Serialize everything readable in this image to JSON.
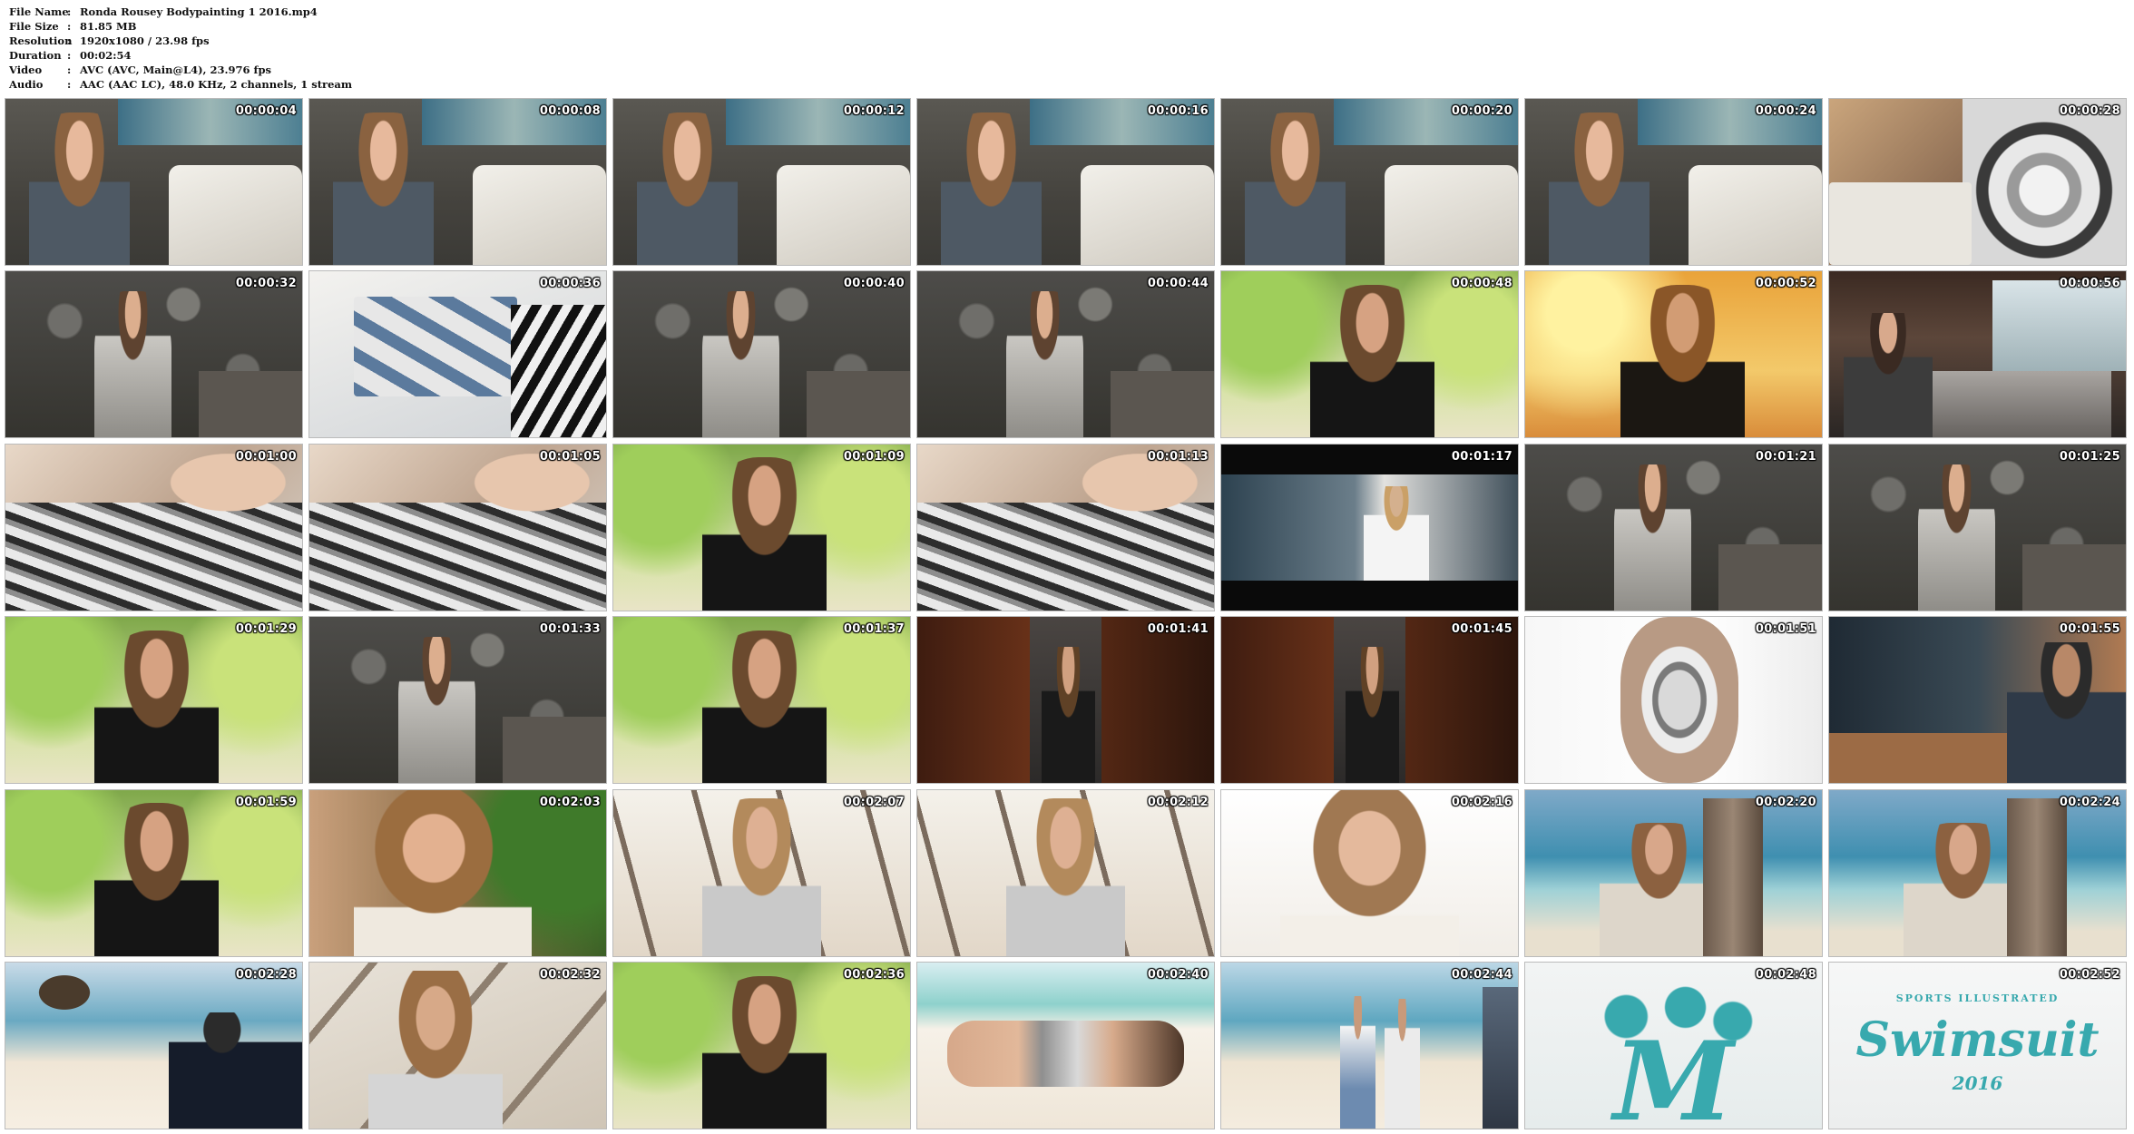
{
  "info": [
    {
      "key": "File Name",
      "value": "Ronda Rousey Bodypainting 1 2016.mp4"
    },
    {
      "key": "File Size",
      "value": "81.85 MB"
    },
    {
      "key": "Resolution",
      "value": "1920x1080 / 23.98 fps"
    },
    {
      "key": "Duration",
      "value": "00:02:54"
    },
    {
      "key": "Video",
      "value": "AVC (AVC, Main@L4), 23.976 fps"
    },
    {
      "key": "Audio",
      "value": "AAC (AAC LC), 48.0 KHz, 2 channels, 1 stream"
    }
  ],
  "info_separator": ":",
  "thumbnails": [
    {
      "time": "00:00:04",
      "scene": "bedroom"
    },
    {
      "time": "00:00:08",
      "scene": "bedroom"
    },
    {
      "time": "00:00:12",
      "scene": "bedroom"
    },
    {
      "time": "00:00:16",
      "scene": "bedroom"
    },
    {
      "time": "00:00:20",
      "scene": "bedroom"
    },
    {
      "time": "00:00:24",
      "scene": "bedroom"
    },
    {
      "time": "00:00:28",
      "scene": "swimsuit-print"
    },
    {
      "time": "00:00:32",
      "scene": "stonewall"
    },
    {
      "time": "00:00:36",
      "scene": "prints-table"
    },
    {
      "time": "00:00:40",
      "scene": "stonewall"
    },
    {
      "time": "00:00:44",
      "scene": "stonewall"
    },
    {
      "time": "00:00:48",
      "scene": "interview-garden"
    },
    {
      "time": "00:00:52",
      "scene": "interview-warm"
    },
    {
      "time": "00:00:56",
      "scene": "studio-room"
    },
    {
      "time": "00:01:00",
      "scene": "closeup-paint"
    },
    {
      "time": "00:01:05",
      "scene": "closeup-paint"
    },
    {
      "time": "00:01:09",
      "scene": "interview-garden"
    },
    {
      "time": "00:01:13",
      "scene": "closeup-paint"
    },
    {
      "time": "00:01:17",
      "scene": "dark-letterbox"
    },
    {
      "time": "00:01:21",
      "scene": "stonewall"
    },
    {
      "time": "00:01:25",
      "scene": "stonewall"
    },
    {
      "time": "00:01:29",
      "scene": "interview-garden"
    },
    {
      "time": "00:01:33",
      "scene": "stonewall"
    },
    {
      "time": "00:01:37",
      "scene": "interview-garden"
    },
    {
      "time": "00:01:41",
      "scene": "wood-door"
    },
    {
      "time": "00:01:45",
      "scene": "wood-door"
    },
    {
      "time": "00:01:51",
      "scene": "white-studio"
    },
    {
      "time": "00:01:55",
      "scene": "photo-shoot"
    },
    {
      "time": "00:01:59",
      "scene": "interview-garden"
    },
    {
      "time": "00:02:03",
      "scene": "portrait-green"
    },
    {
      "time": "00:02:07",
      "scene": "tree-bright"
    },
    {
      "time": "00:02:12",
      "scene": "tree-bright"
    },
    {
      "time": "00:02:16",
      "scene": "portrait-white"
    },
    {
      "time": "00:02:20",
      "scene": "beach-sea"
    },
    {
      "time": "00:02:24",
      "scene": "beach-sea"
    },
    {
      "time": "00:02:28",
      "scene": "beach-shoot"
    },
    {
      "time": "00:02:32",
      "scene": "driftwood"
    },
    {
      "time": "00:02:36",
      "scene": "interview-garden"
    },
    {
      "time": "00:02:40",
      "scene": "lying-sand"
    },
    {
      "time": "00:02:44",
      "scene": "beach-group"
    },
    {
      "time": "00:02:48",
      "scene": "logo-map"
    },
    {
      "time": "00:02:52",
      "scene": "logo-swimsuit"
    }
  ],
  "logo": {
    "brand": "SPORTS ILLUSTRATED",
    "title": "Swimsuit",
    "year": "2016",
    "color": "#38a9ae"
  }
}
